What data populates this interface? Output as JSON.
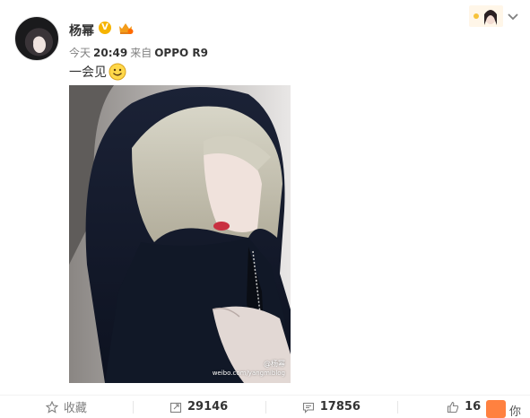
{
  "post": {
    "author": "杨幂",
    "verified_mark": "V",
    "meta": {
      "prefix": "今天",
      "time": "20:49",
      "source_prefix": "来自",
      "device": "OPPO R9"
    },
    "text": "一会见",
    "image_watermark": {
      "name": "@杨幂",
      "url": "weibo.com/yangmiblog"
    }
  },
  "actions": {
    "favorite_label": "收藏",
    "repost_count": "29146",
    "comment_count": "17856",
    "like_count": "16"
  },
  "chat_partial_text": "你",
  "icons": {
    "favorite": "star-icon",
    "repost": "repost-icon",
    "comment": "comment-icon",
    "like": "thumbs-up-icon",
    "dropdown": "chevron-down-icon"
  },
  "colors": {
    "verified": "#f6b400",
    "chat_widget": "#ff8140",
    "meta_gray": "#808080"
  }
}
